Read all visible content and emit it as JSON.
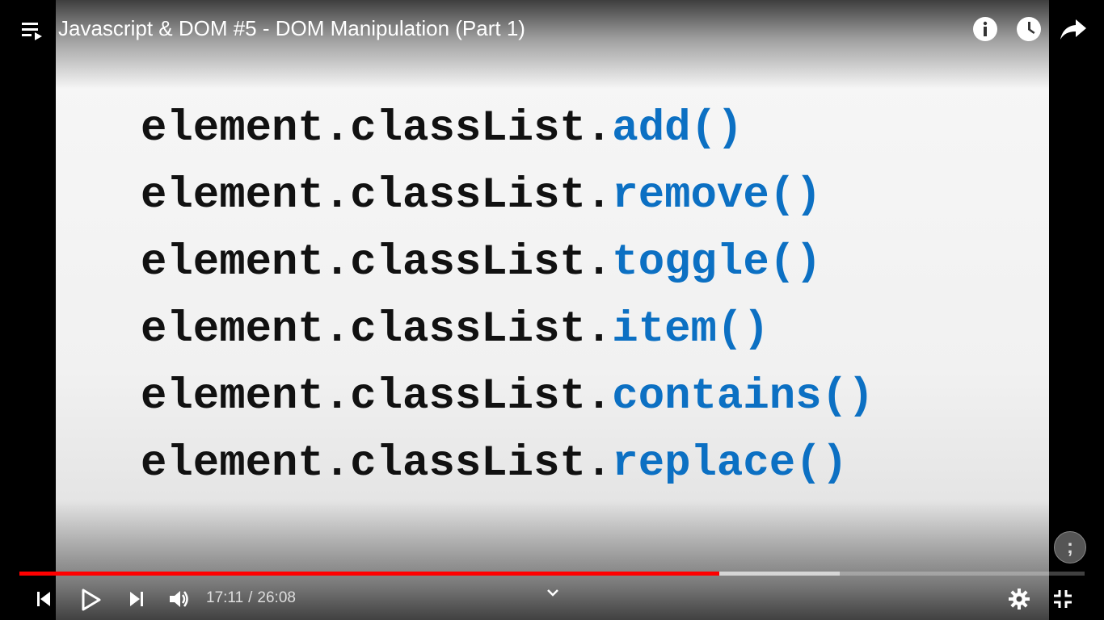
{
  "video": {
    "title": "Javascript & DOM #5 - DOM Manipulation (Part 1)",
    "code_lines": [
      {
        "prefix": "element.classList.",
        "method": "add()"
      },
      {
        "prefix": "element.classList.",
        "method": "remove()"
      },
      {
        "prefix": "element.classList.",
        "method": "toggle()"
      },
      {
        "prefix": "element.classList.",
        "method": "item()"
      },
      {
        "prefix": "element.classList.",
        "method": "contains()"
      },
      {
        "prefix": "element.classList.",
        "method": "replace()"
      }
    ],
    "watermark_glyph": ";"
  },
  "player": {
    "current_time": "17:11",
    "time_separator": "/",
    "duration": "26:08",
    "played_fraction": 0.657,
    "buffered_fraction": 0.77,
    "colors": {
      "progress_played": "#ff0000",
      "code_method": "#0c70c3",
      "code_prefix": "#111111"
    }
  },
  "icons": {
    "top": [
      "playlist-icon",
      "info-icon",
      "watch-later-icon",
      "share-icon"
    ],
    "bottom": [
      "previous-icon",
      "play-icon",
      "next-icon",
      "volume-icon",
      "chevron-down-icon",
      "settings-icon",
      "exit-fullscreen-icon"
    ]
  }
}
